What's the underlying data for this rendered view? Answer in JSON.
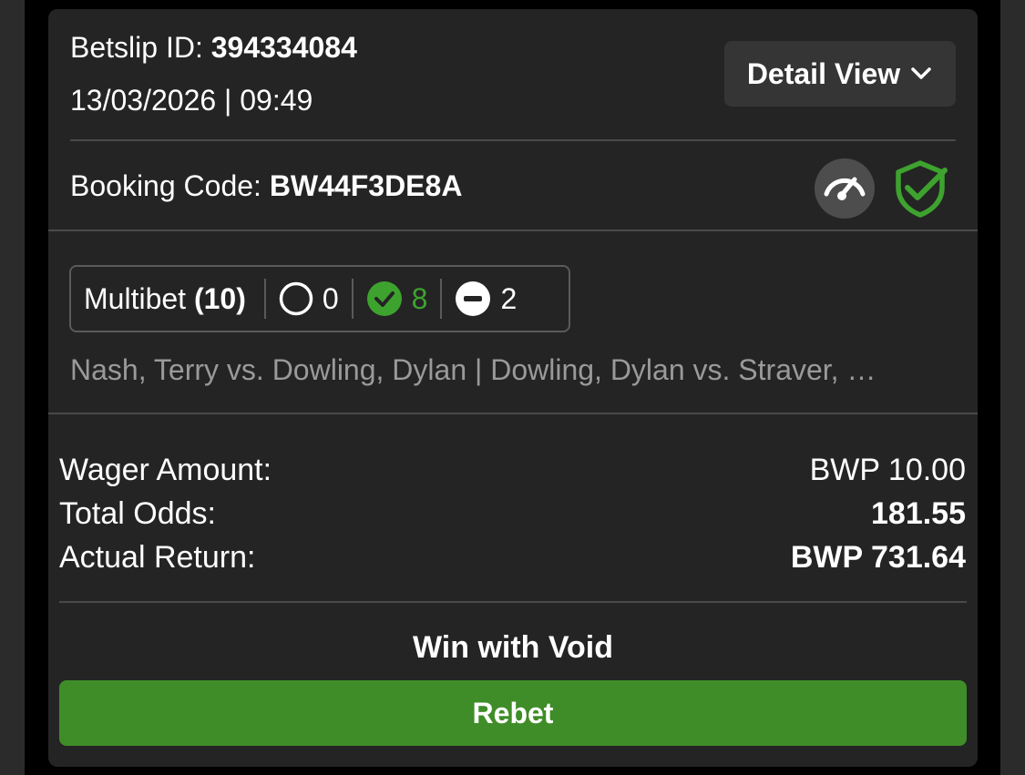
{
  "header": {
    "betslip_label": "Betslip ID:",
    "betslip_id": "394334084",
    "datetime": "13/03/2026 | 09:49",
    "detail_view_label": "Detail View"
  },
  "booking": {
    "label": "Booking Code:",
    "code": "BW44F3DE8A"
  },
  "icons": {
    "gauge": "speedometer-icon",
    "shield": "shield-check-icon",
    "chevron": "chevron-down-icon"
  },
  "multibet": {
    "label": "Multibet",
    "count": "(10)",
    "pending_count": "0",
    "won_count": "8",
    "void_count": "2"
  },
  "events_summary": "Nash, Terry vs. Dowling, Dylan | Dowling, Dylan vs. Straver, …",
  "summary": {
    "wager_label": "Wager Amount:",
    "wager_value": "BWP 10.00",
    "odds_label": "Total Odds:",
    "odds_value": "181.55",
    "return_label": "Actual Return:",
    "return_value": "BWP 731.64"
  },
  "status": "Win with Void",
  "rebet_label": "Rebet",
  "colors": {
    "accent_green": "#3f8d28",
    "won_green": "#3ea22f",
    "card_bg": "#242424",
    "page_bg": "#000000"
  }
}
